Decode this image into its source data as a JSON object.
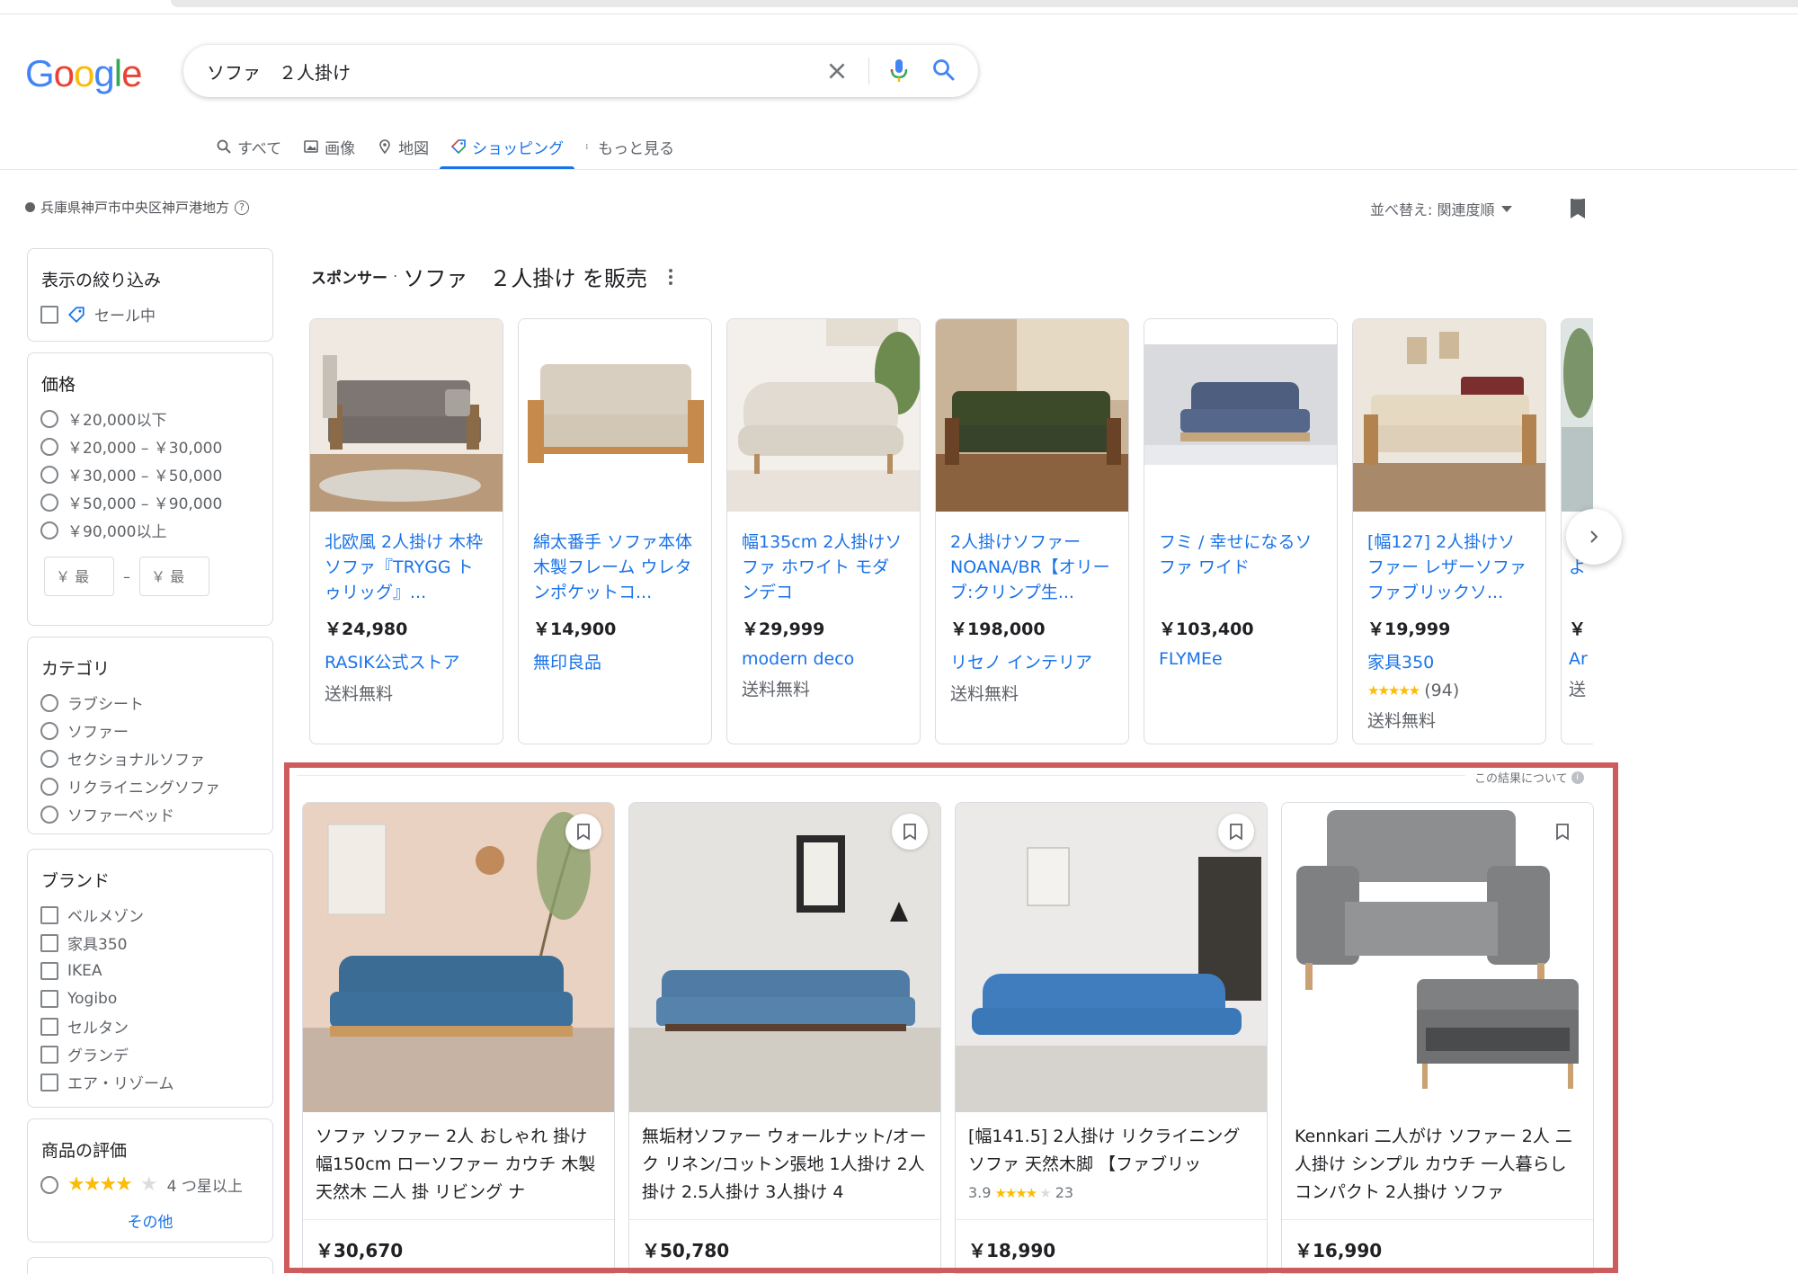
{
  "search": {
    "query": "ソファ　２人掛け"
  },
  "tabs": [
    {
      "label": "すべて"
    },
    {
      "label": "画像"
    },
    {
      "label": "地図"
    },
    {
      "label": "ショッピング"
    },
    {
      "label": "もっと見る"
    }
  ],
  "location": "兵庫県神戸市中央区神戸港地方",
  "sort_label": "並べ替え: 関連度順",
  "sidebar": {
    "filter": {
      "title": "表示の絞り込み",
      "items": [
        "セール中"
      ]
    },
    "price": {
      "title": "価格",
      "options": [
        "￥20,000以下",
        "￥20,000 – ￥30,000",
        "￥30,000 – ￥50,000",
        "￥50,000 – ￥90,000",
        "￥90,000以上"
      ],
      "min_placeholder": "￥ 最",
      "max_placeholder": "￥ 最"
    },
    "category": {
      "title": "カテゴリ",
      "options": [
        "ラブシート",
        "ソファー",
        "セクショナルソファ",
        "リクライニングソファ",
        "ソファーベッド"
      ]
    },
    "brand": {
      "title": "ブランド",
      "options": [
        "ベルメゾン",
        "家具350",
        "IKEA",
        "Yogibo",
        "セルタン",
        "グランデ",
        "エア・リゾーム"
      ]
    },
    "rating": {
      "title": "商品の評価",
      "option": "4 つ星以上",
      "stars": "★★★★",
      "more": "その他"
    }
  },
  "sponsored": {
    "label": "スポンサー",
    "separator": "·",
    "title": "ソファ　２人掛け を販売",
    "products": [
      {
        "title": "北欧風 2人掛け 木枠ソファ『TRYGG トゥリッグ』...",
        "price": "￥24,980",
        "store": "RASIK公式ストア",
        "shipping": "送料無料"
      },
      {
        "title": "綿太番手 ソファ本体 木製フレーム ウレタンポケットコ...",
        "price": "￥14,900",
        "store": "無印良品",
        "shipping": ""
      },
      {
        "title": "幅135cm 2人掛けソファ ホワイト モダンデコ",
        "price": "￥29,999",
        "store": "modern deco",
        "shipping": "送料無料"
      },
      {
        "title": "2人掛けソファー NOANA/BR【オリーブ:クリンプ生...",
        "price": "￥198,000",
        "store": "リセノ インテリア",
        "shipping": "送料無料"
      },
      {
        "title": "フミ / 幸せになるソファ ワイド",
        "price": "￥103,400",
        "store": "FLYMEe",
        "shipping": ""
      },
      {
        "title": "[幅127] 2人掛けソファー レザーソファ ファブリックソ...",
        "price": "￥19,999",
        "store": "家具350",
        "rating_count": "(94)",
        "stars": "★★★★★",
        "shipping": "送料無料"
      },
      {
        "title": "きよ",
        "price": "￥",
        "store": "Ar",
        "shipping": "送"
      }
    ]
  },
  "about_results": "この結果について",
  "results": [
    {
      "title": "ソファ ソファー 2人 おしゃれ 掛け 幅150cm ローソファー カウチ 木製 天然木 二人 掛 リビング ナ",
      "price": "￥30,670"
    },
    {
      "title": "無垢材ソファー ウォールナット/オーク リネン/コットン張地 1人掛け 2人掛け 2.5人掛け 3人掛け 4",
      "price": "￥50,780"
    },
    {
      "title": "[幅141.5] 2人掛け リクライニングソファ 天然木脚 【ファブリッ",
      "rating_value": "3.9",
      "stars": "★★★★",
      "rating_count": "23",
      "price": "￥18,990"
    },
    {
      "title": "Kennkari 二人がけ ソファー 2人 二人掛け シンプル カウチ 一人暮らし コンパクト 2人掛け ソファ",
      "price": "￥16,990"
    }
  ],
  "colors": {
    "accent": "#1a73e8",
    "highlight_border": "#cd5c5c",
    "star": "#fbbc04"
  }
}
